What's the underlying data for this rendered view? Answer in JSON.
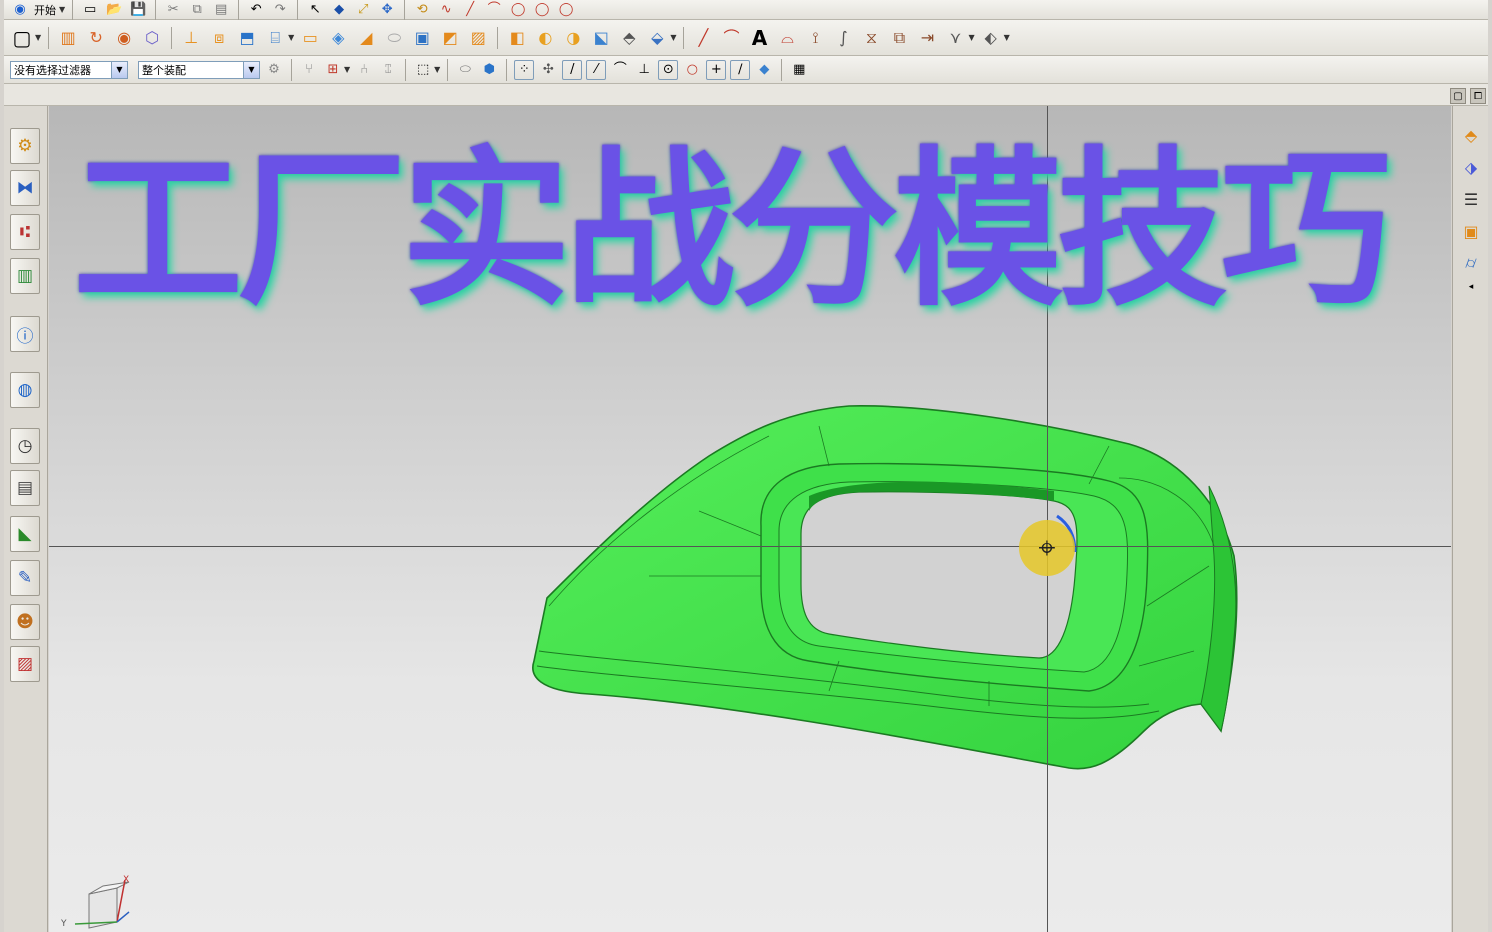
{
  "toolbar_top": {
    "start_label": "开始",
    "icons": [
      "new-file-icon",
      "open-folder-icon",
      "save-icon",
      "cut-icon",
      "copy-icon",
      "paste-icon",
      "undo-icon",
      "redo-icon",
      "select-icon",
      "snap-icon",
      "fit-view-icon",
      "pan-icon",
      "rotate-icon",
      "curve-icon",
      "line-icon",
      "arc-icon",
      "circle-icon"
    ]
  },
  "toolbar_feature": {
    "icons": [
      "sketch-icon",
      "extrude-icon",
      "revolve-icon",
      "hole-icon",
      "boss-icon",
      "pocket-icon",
      "pad-icon",
      "block-icon",
      "cylinder-icon",
      "cone-icon",
      "sphere-icon",
      "edge-blend-icon",
      "chamfer-icon",
      "shell-icon",
      "draft-icon",
      "trim-body-icon",
      "split-body-icon",
      "unite-icon",
      "subtract-icon",
      "intersect-icon",
      "line-tool-icon",
      "arc-tool-icon",
      "text-tool-icon",
      "offset-curve-icon",
      "project-curve-icon",
      "bridge-curve-icon",
      "mirror-curve-icon",
      "wrap-icon",
      "point-icon",
      "plane-icon"
    ]
  },
  "toolbar_selection": {
    "filter_value": "没有选择过滤器",
    "scope_value": "整个装配",
    "snap_symbols": [
      "/",
      "⁄",
      "⌒",
      "⊥",
      "⊙",
      "○",
      "+",
      "∕"
    ]
  },
  "viewport": {
    "overlay_title": "工厂实战分模技巧",
    "axis_labels": {
      "x": "X",
      "y": "Y"
    },
    "colors": {
      "part": "#3ee04a",
      "title": "#6a52e6",
      "title_glow": "#2fd4a4",
      "cursor": "#e6c828"
    }
  },
  "left_resource_bar": {
    "icons": [
      "assembly-navigator-icon",
      "constraint-navigator-icon",
      "part-navigator-icon",
      "reuse-library-icon",
      "hd3d-tools-icon",
      "web-browser-icon",
      "history-icon",
      "process-studio-icon",
      "analysis-icon",
      "system-materials-icon",
      "roles-icon",
      "palette-icon"
    ]
  },
  "right_bar": {
    "icons": [
      "mold-wizard-icon",
      "parting-icon",
      "tree-icon",
      "mold-base-icon",
      "cooling-icon"
    ]
  }
}
